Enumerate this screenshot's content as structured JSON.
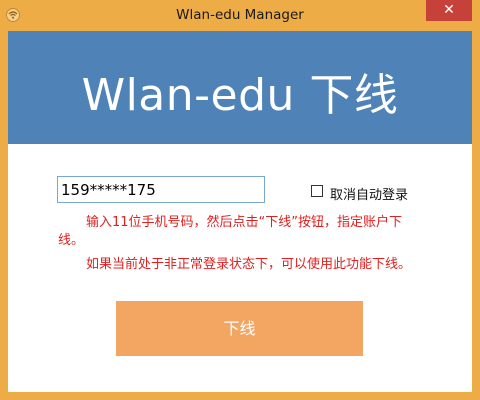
{
  "window": {
    "title": "Wlan-edu Manager",
    "close_glyph": "✕",
    "icon": "wifi-icon"
  },
  "banner": {
    "title": "Wlan-edu 下线"
  },
  "form": {
    "phone_value": "159*****175",
    "auto_login_label": "取消自动登录",
    "auto_login_checked": false,
    "hint_1": "输入11位手机号码，然后点击“下线”按钮，指定账户下线。",
    "hint_2": "如果当前处于非正常登录状态下，可以使用此功能下线。",
    "logout_label": "下线"
  },
  "colors": {
    "frame": "#edac46",
    "banner": "#4f82b6",
    "close": "#c7413b",
    "button": "#f3a562",
    "hint": "#e02020"
  }
}
